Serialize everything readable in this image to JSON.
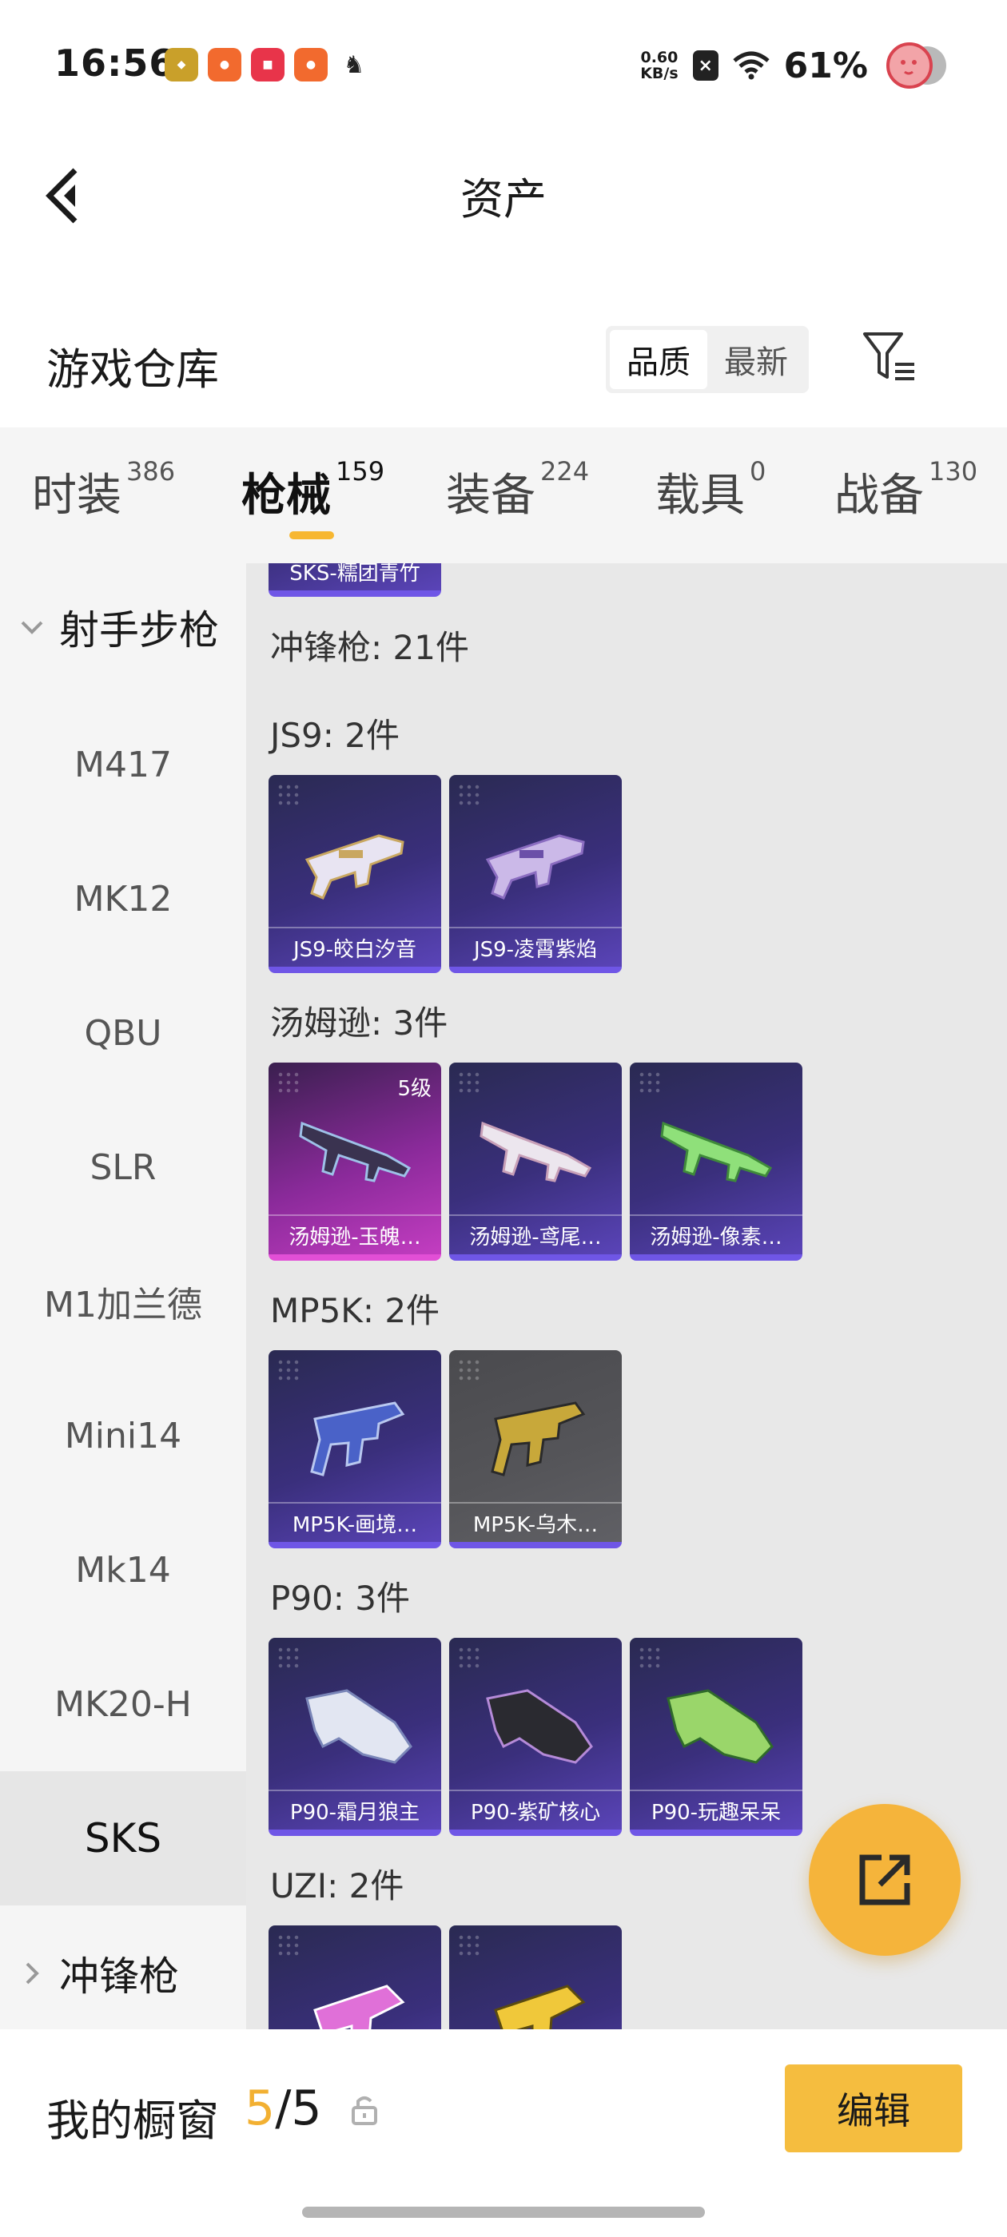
{
  "status_bar": {
    "time": "16:56",
    "speed_value": "0.60",
    "speed_unit": "KB/s",
    "battery": "61%",
    "apps": [
      "app-game-icon",
      "app-kuaishou-icon",
      "app-xiaohongshu-icon",
      "app-kuaishou-icon",
      "app-horse-icon"
    ]
  },
  "header": {
    "title": "资产"
  },
  "warehouse": {
    "title": "游戏仓库",
    "sort_options": [
      "品质",
      "最新"
    ],
    "active_sort": "品质"
  },
  "tabs": [
    {
      "label": "时装",
      "count": "386"
    },
    {
      "label": "枪械",
      "count": "159"
    },
    {
      "label": "装备",
      "count": "224"
    },
    {
      "label": "载具",
      "count": "0"
    },
    {
      "label": "战备",
      "count": "130"
    }
  ],
  "active_tab": "枪械",
  "sidebar": {
    "group_open": "射手步枪",
    "items": [
      "M417",
      "MK12",
      "QBU",
      "SLR",
      "M1加兰德",
      "Mini14",
      "Mk14",
      "MK20-H",
      "SKS"
    ],
    "active_item": "SKS",
    "group_closed": "冲锋枪"
  },
  "content": {
    "partial_top_card": "SKS-糯团青竹",
    "category_header": "冲锋枪: 21件",
    "sections": [
      {
        "label": "JS9: 2件",
        "items": [
          {
            "name": "JS9-皎白汐音",
            "rarity": "purple",
            "level": ""
          },
          {
            "name": "JS9-凌霄紫焰",
            "rarity": "purple",
            "level": ""
          }
        ]
      },
      {
        "label": "汤姆逊: 3件",
        "items": [
          {
            "name": "汤姆逊-玉魄…",
            "rarity": "pink",
            "level": "5级"
          },
          {
            "name": "汤姆逊-鸢尾…",
            "rarity": "purple",
            "level": ""
          },
          {
            "name": "汤姆逊-像素…",
            "rarity": "purple",
            "level": ""
          }
        ]
      },
      {
        "label": "MP5K: 2件",
        "items": [
          {
            "name": "MP5K-画境…",
            "rarity": "purple",
            "level": ""
          },
          {
            "name": "MP5K-乌木…",
            "rarity": "gray",
            "level": ""
          }
        ]
      },
      {
        "label": "P90: 3件",
        "items": [
          {
            "name": "P90-霜月狼主",
            "rarity": "purple",
            "level": ""
          },
          {
            "name": "P90-紫矿核心",
            "rarity": "purple",
            "level": ""
          },
          {
            "name": "P90-玩趣呆呆",
            "rarity": "purple",
            "level": ""
          }
        ]
      },
      {
        "label": "UZI: 2件",
        "items": [
          {
            "name": "",
            "rarity": "purple",
            "level": ""
          },
          {
            "name": "",
            "rarity": "purple",
            "level": ""
          }
        ]
      }
    ]
  },
  "bottom": {
    "window_label": "我的橱窗",
    "count_current": "5",
    "count_total": "/5",
    "edit_label": "编辑"
  },
  "colors": {
    "accent": "#f5bd3f",
    "tab_indicator": "#f7b731",
    "purple_rarity": "#6f56e6",
    "pink_rarity": "#e24fd6"
  }
}
